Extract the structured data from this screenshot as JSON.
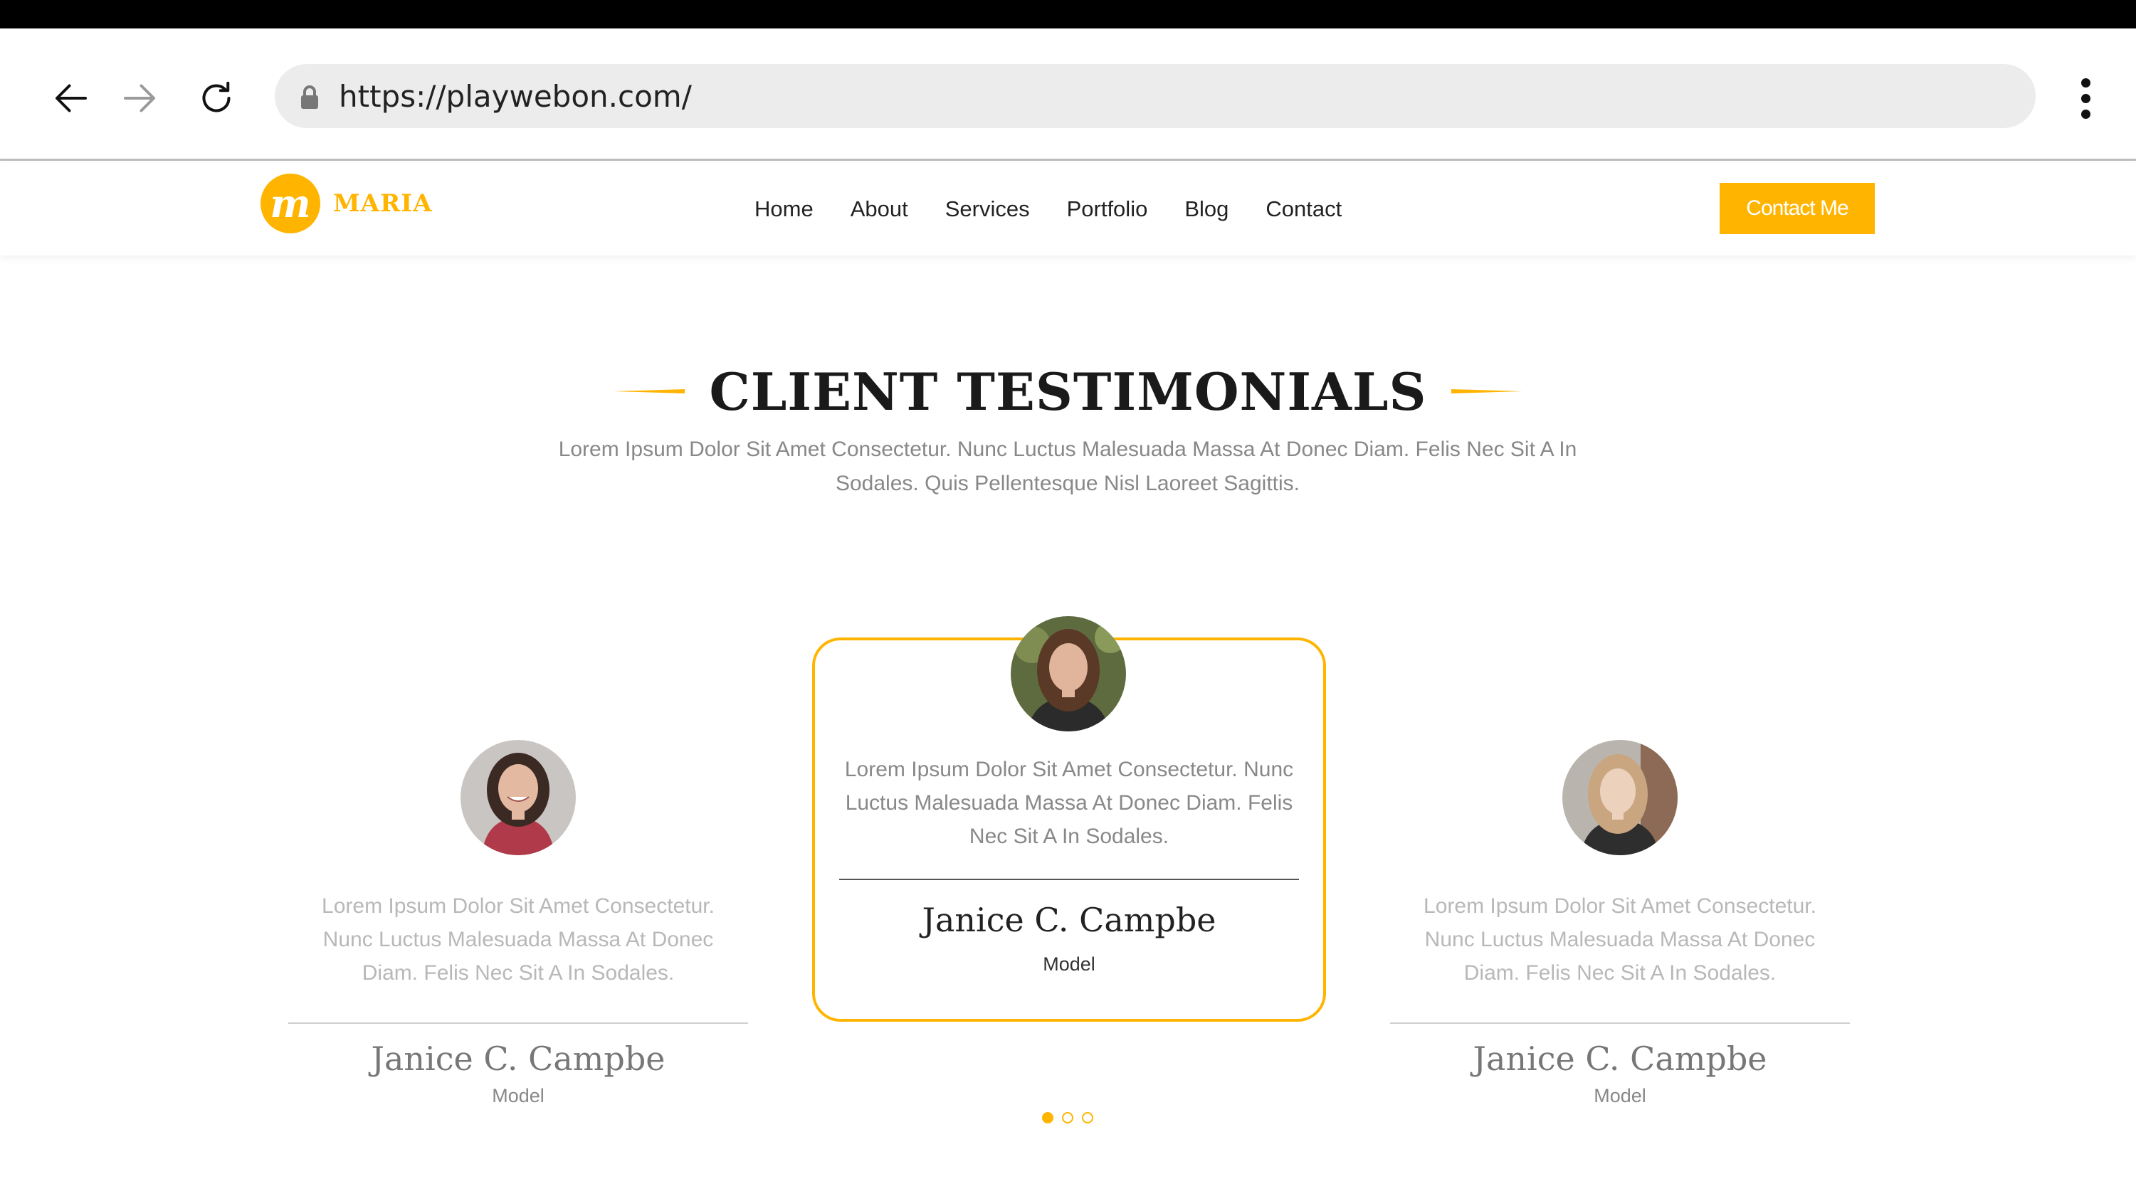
{
  "browser": {
    "url": "https://playwebon.com/",
    "icons": [
      "back-arrow-icon",
      "forward-arrow-icon",
      "reload-icon",
      "lock-icon",
      "kebab-menu-icon"
    ]
  },
  "header": {
    "logo_mark": "m",
    "logo_text": "MARIA",
    "nav": [
      "Home",
      "About",
      "Services",
      "Portfolio",
      "Blog",
      "Contact"
    ],
    "cta_label": "Contact Me"
  },
  "testimonials_section": {
    "title": "CLIENT TESTIMONIALS",
    "subtitle": "Lorem Ipsum Dolor Sit Amet Consectetur. Nunc Luctus Malesuada Massa At Donec Diam. Felis Nec Sit A In Sodales. Quis Pellentesque Nisl Laoreet Sagittis.",
    "cards": [
      {
        "quote": "Lorem Ipsum Dolor Sit Amet Consectetur. Nunc Luctus Malesuada Massa At Donec Diam. Felis Nec Sit A In Sodales.",
        "name": "Janice C. Campbe",
        "role": "Model"
      },
      {
        "quote": "Lorem Ipsum Dolor Sit Amet Consectetur. Nunc Luctus Malesuada Massa At Donec Diam. Felis Nec Sit A In Sodales.",
        "name": "Janice C. Campbe",
        "role": "Model"
      },
      {
        "quote": "Lorem Ipsum Dolor Sit Amet Consectetur. Nunc Luctus Malesuada Massa At Donec Diam. Felis Nec Sit A In Sodales.",
        "name": "Janice C. Campbe",
        "role": "Model"
      }
    ],
    "carousel_pages": 3,
    "active_page": 1
  },
  "colors": {
    "accent": "#ffb400",
    "heading": "#1a1a1a",
    "muted_text": "#888888"
  }
}
